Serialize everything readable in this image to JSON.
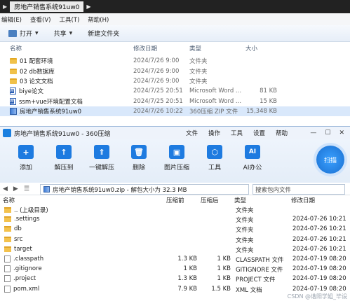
{
  "explorer": {
    "breadcrumb": "房地产销售系统91uw0",
    "menu": [
      "编辑(E)",
      "查看(V)",
      "工具(T)",
      "帮助(H)"
    ],
    "toolbar": {
      "open": "打开",
      "share": "共享",
      "new_folder": "新建文件夹"
    },
    "columns": {
      "name": "名称",
      "date": "修改日期",
      "type": "类型",
      "size": "大小"
    },
    "rows": [
      {
        "name": "01 配套环境",
        "date": "2024/7/26 9:00",
        "type": "文件夹",
        "size": "",
        "icon": "folder-icon"
      },
      {
        "name": "02 db数据库",
        "date": "2024/7/26 9:00",
        "type": "文件夹",
        "size": "",
        "icon": "folder-icon"
      },
      {
        "name": "03 论文文档",
        "date": "2024/7/26 9:00",
        "type": "文件夹",
        "size": "",
        "icon": "folder-icon"
      },
      {
        "name": "biye论文",
        "date": "2024/7/25 20:51",
        "type": "Microsoft Word ...",
        "size": "81 KB",
        "icon": "word-doc-icon"
      },
      {
        "name": "ssm+vue环境配置文档",
        "date": "2024/7/25 20:51",
        "type": "Microsoft Word ...",
        "size": "15 KB",
        "icon": "word-doc-icon"
      },
      {
        "name": "房地产销售系统91uw0",
        "date": "2024/7/26 10:22",
        "type": "360压缩 ZIP 文件",
        "size": "15,348 KB",
        "icon": "zip-icon"
      }
    ]
  },
  "zip": {
    "title": "房地产销售系统91uw0 - 360压缩",
    "menu": [
      "文件",
      "操作",
      "工具",
      "设置",
      "帮助"
    ],
    "tools": [
      {
        "label": "添加",
        "icon": "add-icon"
      },
      {
        "label": "解压到",
        "icon": "extract-to-icon"
      },
      {
        "label": "一键解压",
        "icon": "one-click-extract-icon"
      },
      {
        "label": "删除",
        "icon": "delete-icon"
      },
      {
        "label": "图片压缩",
        "icon": "image-compress-icon"
      },
      {
        "label": "工具",
        "icon": "tools-icon"
      },
      {
        "label": "AI办公",
        "icon": "ai-office-icon"
      }
    ],
    "scan_label": "扫描",
    "path": "房地产销售系统91uw0.zip - 解包大小为 32.3 MB",
    "search_placeholder": "搜索包内文件",
    "columns": {
      "name": "名称",
      "orig": "压缩前",
      "comp": "压缩后",
      "type": "类型",
      "date": "修改日期"
    },
    "rows": [
      {
        "name": ".. (上级目录)",
        "orig": "",
        "comp": "",
        "type": "文件夹",
        "date": "",
        "icon": "folder-icon"
      },
      {
        "name": ".settings",
        "orig": "",
        "comp": "",
        "type": "文件夹",
        "date": "2024-07-26 10:21",
        "icon": "folder-icon"
      },
      {
        "name": "db",
        "orig": "",
        "comp": "",
        "type": "文件夹",
        "date": "2024-07-26 10:21",
        "icon": "folder-icon"
      },
      {
        "name": "src",
        "orig": "",
        "comp": "",
        "type": "文件夹",
        "date": "2024-07-26 10:21",
        "icon": "folder-icon"
      },
      {
        "name": "target",
        "orig": "",
        "comp": "",
        "type": "文件夹",
        "date": "2024-07-26 10:21",
        "icon": "folder-icon"
      },
      {
        "name": ".classpath",
        "orig": "1.3 KB",
        "comp": "1 KB",
        "type": "CLASSPATH 文件",
        "date": "2024-07-19 08:20",
        "icon": "file-icon"
      },
      {
        "name": ".gitignore",
        "orig": "1 KB",
        "comp": "1 KB",
        "type": "GITIGNORE 文件",
        "date": "2024-07-19 08:20",
        "icon": "file-icon"
      },
      {
        "name": ".project",
        "orig": "1.3 KB",
        "comp": "1 KB",
        "type": "PROJECT 文件",
        "date": "2024-07-19 08:20",
        "icon": "file-icon"
      },
      {
        "name": "pom.xml",
        "orig": "7.9 KB",
        "comp": "1.5 KB",
        "type": "XML 文档",
        "date": "2024-07-19 08:20",
        "icon": "file-icon"
      }
    ]
  },
  "watermark": "CSDN @谐阳学姐_毕设"
}
